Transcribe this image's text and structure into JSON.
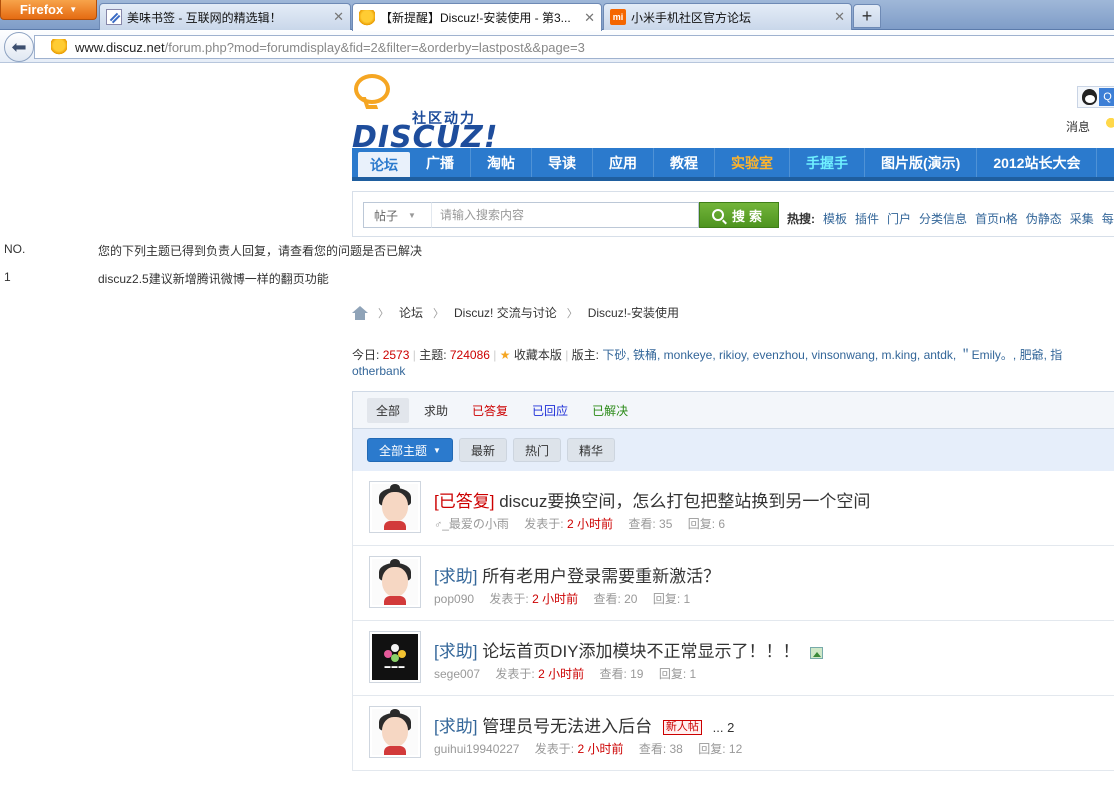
{
  "browser": {
    "firefox_label": "Firefox",
    "tabs": [
      {
        "label": "美味书签 - 互联网的精选辑！"
      },
      {
        "label": "【新提醒】Discuz!-安装使用 - 第3..."
      },
      {
        "label": "小米手机社区官方论坛"
      }
    ],
    "new_tab": "+",
    "url_host": "www.discuz.net",
    "url_path": "/forum.php?mod=forumdisplay&fid=2&filter=&orderby=lastpost&&page=3"
  },
  "header": {
    "logo_sub": "社区动力",
    "logo_main": "DISCUZ!",
    "qq_label": "Q",
    "messages": "消息"
  },
  "nav": {
    "items": [
      "论坛",
      "广播",
      "淘帖",
      "导读",
      "应用",
      "教程",
      "实验室",
      "手握手",
      "图片版(演示)",
      "2012站长大会"
    ]
  },
  "search": {
    "type": "帖子",
    "placeholder": "请输入搜索内容",
    "button": "搜索",
    "hot_label": "热搜:",
    "hot": [
      "模板",
      "插件",
      "门户",
      "分类信息",
      "首页n格",
      "伪静态",
      "采集",
      "每"
    ]
  },
  "notice": {
    "no_label": "NO.",
    "message": "您的下列主题已得到负责人回复，请查看您的问题是否已解决",
    "row_no": "1",
    "row_text": "discuz2.5建议新增腾讯微博一样的翻页功能"
  },
  "breadcrumb": [
    "论坛",
    "Discuz! 交流与讨论",
    "Discuz!-安装使用"
  ],
  "stats": {
    "today_label": "今日:",
    "today": "2573",
    "topics_label": "主题:",
    "topics": "724086",
    "fav": "收藏本版",
    "mods_label": "版主:",
    "mods": "下砂, 铁桶, monkeye, rikioy, evenzhou, vinsonwang, m.king, antdk, ＂Emily。, 肥爺, 指",
    "mods_line2": "otherbank"
  },
  "filters": {
    "tabs": [
      "全部",
      "求助",
      "已答复",
      "已回应",
      "已解决"
    ],
    "buttons": [
      "全部主题",
      "最新",
      "热门",
      "精华"
    ]
  },
  "threads": [
    {
      "type": "[已答复]",
      "title": "discuz要换空间，怎么打包把整站换到另一个空间",
      "author": "_最爱の小雨",
      "posted_label": "发表于:",
      "time": "2 小时前",
      "views_label": "查看:",
      "views": "35",
      "replies_label": "回复:",
      "replies": "6"
    },
    {
      "type": "[求助]",
      "title": "所有老用户登录需要重新激活？",
      "author": "pop090",
      "posted_label": "发表于:",
      "time": "2 小时前",
      "views_label": "查看:",
      "views": "20",
      "replies_label": "回复:",
      "replies": "1"
    },
    {
      "type": "[求助]",
      "title": "论坛首页DIY添加模块不正常显示了！！！",
      "author": "sege007",
      "posted_label": "发表于:",
      "time": "2 小时前",
      "views_label": "查看:",
      "views": "19",
      "replies_label": "回复:",
      "replies": "1"
    },
    {
      "type": "[求助]",
      "title": "管理员号无法进入后台",
      "badge": "新人帖",
      "pages": "... 2",
      "author": "guihui19940227",
      "posted_label": "发表于:",
      "time": "2 小时前",
      "views_label": "查看:",
      "views": "38",
      "replies_label": "回复:",
      "replies": "12"
    }
  ]
}
